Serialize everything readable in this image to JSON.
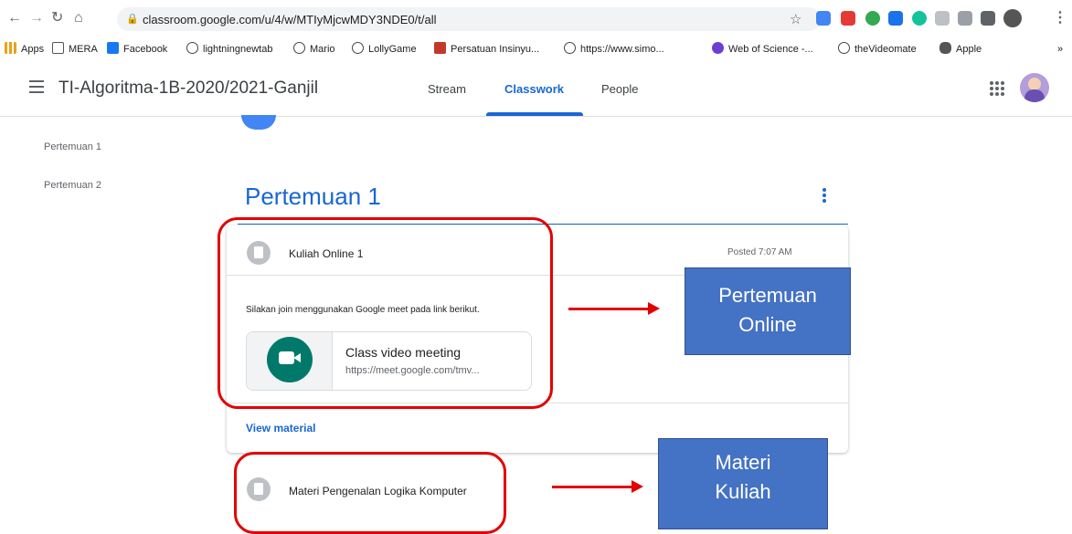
{
  "browser": {
    "url": "classroom.google.com/u/4/w/MTIyMjcwMDY3NDE0/t/all",
    "bookmarks": [
      {
        "label": "Apps"
      },
      {
        "label": "MERA"
      },
      {
        "label": "Facebook"
      },
      {
        "label": "lightningnewtab"
      },
      {
        "label": "Mario"
      },
      {
        "label": "LollyGame"
      },
      {
        "label": "Persatuan Insinyu..."
      },
      {
        "label": "https://www.simo..."
      },
      {
        "label": "Web of Science -..."
      },
      {
        "label": "theVideomate"
      },
      {
        "label": "Apple"
      }
    ],
    "overflow": "»",
    "colors": {
      "accent": "#1967d2"
    }
  },
  "header": {
    "class_title": "TI-Algoritma-1B-2020/2021-Ganjil",
    "tabs": [
      {
        "label": "Stream"
      },
      {
        "label": "Classwork",
        "active": true
      },
      {
        "label": "People"
      }
    ]
  },
  "sidebar": {
    "topics": [
      {
        "label": "Pertemuan 1"
      },
      {
        "label": "Pertemuan 2"
      }
    ]
  },
  "main": {
    "section_title": "Pertemuan 1",
    "card": {
      "title": "Kuliah Online 1",
      "posted": "Posted 7:07 AM",
      "description": "Silakan join menggunakan Google meet pada link berikut.",
      "attachment": {
        "title": "Class video meeting",
        "url": "https://meet.google.com/tmv..."
      },
      "action": "View material"
    },
    "item2": {
      "title": "Materi Pengenalan Logika Komputer"
    }
  },
  "annotations": {
    "callout1": [
      "Pertemuan",
      "Online"
    ],
    "callout2": [
      "Materi",
      "Kuliah"
    ],
    "colors": {
      "box": "#e30000",
      "callout": "#4472c4"
    }
  }
}
